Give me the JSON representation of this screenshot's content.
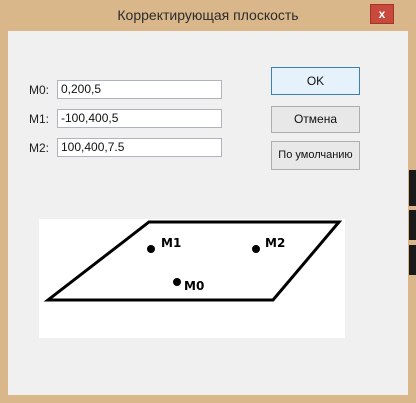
{
  "window": {
    "title": "Корректирующая плоскость",
    "close_symbol": "x"
  },
  "fields": [
    {
      "label": "M0:",
      "value": "0,200,5"
    },
    {
      "label": "M1:",
      "value": "-100,400,5"
    },
    {
      "label": "M2:",
      "value": "100,400,7.5"
    }
  ],
  "buttons": {
    "ok": "OK",
    "cancel": "Отмена",
    "default": "По умолчанию"
  },
  "diagram": {
    "points": [
      {
        "label": "M1"
      },
      {
        "label": "M2"
      },
      {
        "label": "M0"
      }
    ]
  }
}
